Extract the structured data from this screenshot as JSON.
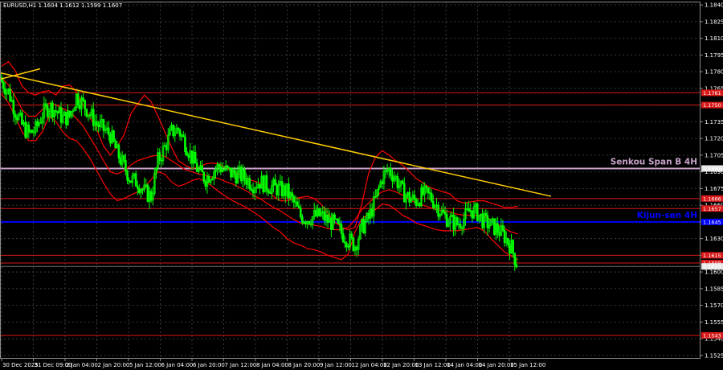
{
  "chart_data": {
    "type": "line",
    "title": "EURUSD,H1  1.1604 1.1612 1.1599 1.1607",
    "symbol": "EURUSD,H1",
    "ohlc": [
      "1.1604",
      "1.1612",
      "1.1599",
      "1.1607"
    ],
    "colors": {
      "background": "#000000",
      "grid": "#3a3a3a",
      "candle": "#00ff00",
      "ichimoku": "#ff0000",
      "trend": "#ffcc00",
      "kijun": "#0000ff",
      "senkou": "#c8a2c8",
      "level": "#d81818",
      "label_bg": "#d81818",
      "axis_text": "#ffffff"
    },
    "ylim": [
      1.1522,
      1.1843
    ],
    "y_ticks": [
      "1.1840",
      "1.1825",
      "1.1810",
      "1.1795",
      "1.1780",
      "1.1765",
      "1.1750",
      "1.1735",
      "1.1720",
      "1.1705",
      "1.1690",
      "1.1675",
      "1.1660",
      "1.1645",
      "1.1630",
      "1.1615",
      "1.1600",
      "1.1585",
      "1.1570",
      "1.1555",
      "1.1540",
      "1.1525"
    ],
    "x_ticks": [
      "30 Dec 2025",
      "31 Dec 09:00",
      "2 Jan 04:00",
      "2 Jan 20:00",
      "5 Jan 12:00",
      "6 Jan 04:00",
      "6 Jan 20:00",
      "7 Jan 12:00",
      "8 Jan 04:00",
      "8 Jan 20:00",
      "9 Jan 12:00",
      "12 Jan 04:00",
      "12 Jan 20:00",
      "13 Jan 12:00",
      "14 Jan 04:00",
      "14 Jan 20:00",
      "15 Jan 12:00"
    ],
    "price_levels": [
      {
        "price": 1.1761,
        "label": "1.1761",
        "kind": "support-resistance"
      },
      {
        "price": 1.175,
        "label": "1.1750",
        "kind": "support-resistance"
      },
      {
        "price": 1.1693,
        "label": "1.1693",
        "kind": "senkou-span-b"
      },
      {
        "price": 1.1666,
        "label": "1.1666",
        "kind": "support-resistance"
      },
      {
        "price": 1.1657,
        "label": "1.1657",
        "kind": "support-resistance"
      },
      {
        "price": 1.1645,
        "label": "1.1645",
        "kind": "kijun-sen"
      },
      {
        "price": 1.1615,
        "label": "1.1615",
        "kind": "support-resistance"
      },
      {
        "price": 1.1608,
        "label": "1.1608",
        "kind": "support-resistance"
      },
      {
        "price": 1.1605,
        "label": "1.1605",
        "kind": "current-price"
      },
      {
        "price": 1.1543,
        "label": "1.1543",
        "kind": "support-resistance"
      }
    ],
    "annotations": [
      {
        "text": "Senkou Span B 4H",
        "price": 1.1693,
        "color": "#c8a2c8"
      },
      {
        "text": "Kijun-sen 4H",
        "price": 1.1645,
        "color": "#0000ff"
      }
    ],
    "trendline": [
      {
        "x": 0,
        "y": 1.1779
      },
      {
        "x": 1,
        "y": 1.1668
      }
    ],
    "close": [
      1.1771,
      1.1762,
      1.1745,
      1.1732,
      1.1724,
      1.1728,
      1.1742,
      1.1749,
      1.1745,
      1.1738,
      1.174,
      1.1758,
      1.1751,
      1.1742,
      1.1733,
      1.1728,
      1.1723,
      1.1707,
      1.1695,
      1.1683,
      1.1681,
      1.1672,
      1.1668,
      1.17,
      1.1712,
      1.1726,
      1.1728,
      1.1716,
      1.1703,
      1.169,
      1.1684,
      1.169,
      1.1695,
      1.1691,
      1.1688,
      1.1687,
      1.1684,
      1.1679,
      1.1681,
      1.1678,
      1.1676,
      1.1674,
      1.1672,
      1.1662,
      1.165,
      1.1648,
      1.165,
      1.1651,
      1.1646,
      1.1643,
      1.1635,
      1.1629,
      1.1624,
      1.164,
      1.1648,
      1.1665,
      1.1685,
      1.1692,
      1.1684,
      1.1672,
      1.1666,
      1.1664,
      1.167,
      1.1668,
      1.166,
      1.1651,
      1.1646,
      1.1643,
      1.1648,
      1.1656,
      1.1653,
      1.1645,
      1.1642,
      1.1638,
      1.1632,
      1.1622,
      1.1604
    ],
    "upper_band": [
      1.1785,
      1.1789,
      1.1781,
      1.1767,
      1.1761,
      1.1759,
      1.1762,
      1.1763,
      1.1759,
      1.1767,
      1.1768,
      1.1762,
      1.175,
      1.1739,
      1.1728,
      1.1713,
      1.1705,
      1.1713,
      1.1723,
      1.1742,
      1.1751,
      1.1759,
      1.1753,
      1.174,
      1.1726,
      1.1712,
      1.17,
      1.1696,
      1.1693,
      1.1694,
      1.1697,
      1.1698,
      1.1697,
      1.1694,
      1.169,
      1.1688,
      1.1684,
      1.1682,
      1.168,
      1.1675,
      1.1668,
      1.1664,
      1.1664,
      1.1666,
      1.1667,
      1.1668,
      1.1666,
      1.1661,
      1.1653,
      1.1645,
      1.164,
      1.1638,
      1.164,
      1.1661,
      1.1689,
      1.1703,
      1.1709,
      1.1705,
      1.17,
      1.1696,
      1.169,
      1.1684,
      1.168,
      1.1676,
      1.1674,
      1.1672,
      1.167,
      1.1664,
      1.1662,
      1.1663,
      1.1664,
      1.1664,
      1.1662,
      1.166,
      1.1658,
      1.1658,
      1.1659
    ],
    "lower_band": [
      1.176,
      1.1752,
      1.174,
      1.1726,
      1.1718,
      1.1718,
      1.1726,
      1.174,
      1.1735,
      1.1726,
      1.172,
      1.1718,
      1.1711,
      1.1702,
      1.1691,
      1.168,
      1.167,
      1.1664,
      1.1666,
      1.1669,
      1.1672,
      1.1676,
      1.1683,
      1.169,
      1.1688,
      1.1681,
      1.1677,
      1.1679,
      1.1682,
      1.1684,
      1.1681,
      1.1677,
      1.1672,
      1.1668,
      1.1664,
      1.1661,
      1.1658,
      1.1654,
      1.165,
      1.1645,
      1.164,
      1.1636,
      1.163,
      1.1626,
      1.1624,
      1.1621,
      1.162,
      1.1618,
      1.1615,
      1.1613,
      1.1611,
      1.1616,
      1.1636,
      1.1648,
      1.1652,
      1.1656,
      1.1661,
      1.166,
      1.1656,
      1.1651,
      1.1648,
      1.1644,
      1.1642,
      1.164,
      1.1638,
      1.1637,
      1.1637,
      1.1637,
      1.1638,
      1.1639,
      1.164,
      1.1637,
      1.163,
      1.1624,
      1.1618,
      1.1614,
      1.1611
    ],
    "mid_line": [
      1.1775,
      1.1768,
      1.1758,
      1.1746,
      1.174,
      1.174,
      1.1746,
      1.1752,
      1.175,
      1.1747,
      1.1744,
      1.1738,
      1.1731,
      1.1721,
      1.1711,
      1.17,
      1.169,
      1.1688,
      1.1691,
      1.1696,
      1.17,
      1.1702,
      1.1704,
      1.1705,
      1.1704,
      1.17,
      1.1696,
      1.1692,
      1.169,
      1.1688,
      1.1687,
      1.1685,
      1.1684,
      1.1681,
      1.1679,
      1.1676,
      1.1673,
      1.1669,
      1.1666,
      1.1662,
      1.1658,
      1.1655,
      1.1651,
      1.1647,
      1.1644,
      1.1643,
      1.1642,
      1.1641,
      1.1639,
      1.1638,
      1.1638,
      1.164,
      1.1647,
      1.1656,
      1.1662,
      1.1668,
      1.1672,
      1.1674,
      1.1672,
      1.1669,
      1.1665,
      1.1662,
      1.166,
      1.1658,
      1.1656,
      1.1655,
      1.1654,
      1.1652,
      1.1651,
      1.1651,
      1.1651,
      1.165,
      1.1647,
      1.1643,
      1.1639,
      1.1636,
      1.1634
    ]
  }
}
